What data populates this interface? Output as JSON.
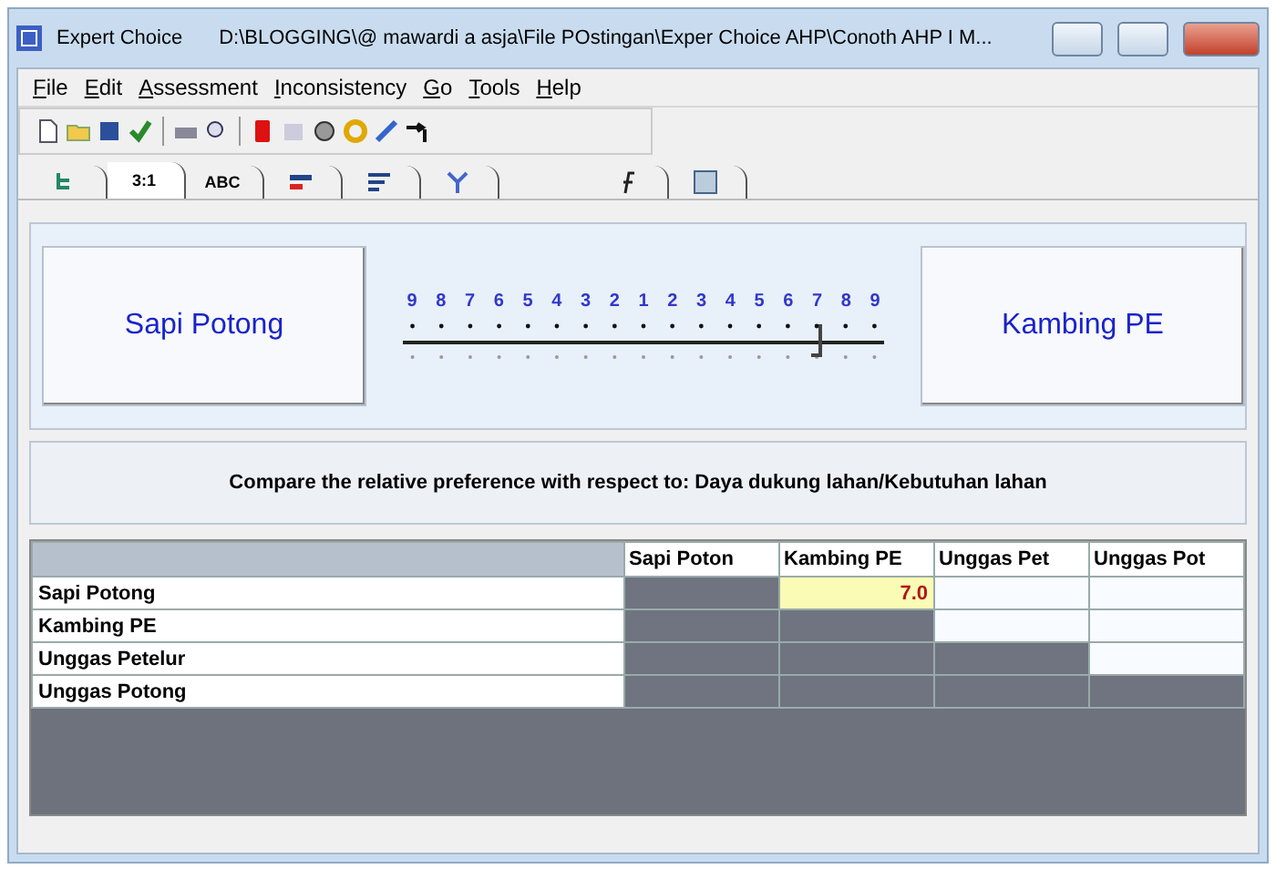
{
  "window": {
    "title": "Expert Choice",
    "path": "D:\\BLOGGING\\@ mawardi a asja\\File POstingan\\Exper Choice AHP\\Conoth AHP I M..."
  },
  "menu": [
    {
      "label": "File"
    },
    {
      "label": "Edit"
    },
    {
      "label": "Assessment"
    },
    {
      "label": "Inconsistency"
    },
    {
      "label": "Go"
    },
    {
      "label": "Tools"
    },
    {
      "label": "Help"
    }
  ],
  "tabs": [
    {
      "kind": "tree",
      "selected": false
    },
    {
      "kind": "text",
      "label": "3:1",
      "selected": true
    },
    {
      "kind": "text",
      "label": "ABC",
      "selected": false
    },
    {
      "kind": "bars",
      "selected": false
    },
    {
      "kind": "lines",
      "selected": false
    },
    {
      "kind": "arrows",
      "selected": false
    },
    {
      "kind": "formula",
      "selected": false
    },
    {
      "kind": "table",
      "selected": false
    }
  ],
  "comparison": {
    "left": "Sapi Potong",
    "right": "Kambing PE",
    "scale": [
      "9",
      "8",
      "7",
      "6",
      "5",
      "4",
      "3",
      "2",
      "1",
      "2",
      "3",
      "4",
      "5",
      "6",
      "7",
      "8",
      "9"
    ],
    "level": 0.875
  },
  "prompt": "Compare the relative preference with respect to: Daya dukung lahan/Kebutuhan lahan",
  "matrix": {
    "columns": [
      "Sapi Poton",
      "Kambing PE",
      "Unggas Pet",
      "Unggas Pot"
    ],
    "rows": [
      {
        "label": "Sapi Potong",
        "cells": [
          {
            "kind": "grey"
          },
          {
            "kind": "value",
            "text": "7.0"
          },
          {
            "kind": "blank"
          },
          {
            "kind": "blank"
          }
        ]
      },
      {
        "label": "Kambing PE",
        "cells": [
          {
            "kind": "grey"
          },
          {
            "kind": "grey"
          },
          {
            "kind": "blank"
          },
          {
            "kind": "blank"
          }
        ]
      },
      {
        "label": "Unggas Petelur",
        "cells": [
          {
            "kind": "grey"
          },
          {
            "kind": "grey"
          },
          {
            "kind": "grey"
          },
          {
            "kind": "blank"
          }
        ]
      },
      {
        "label": "Unggas Potong",
        "cells": [
          {
            "kind": "grey"
          },
          {
            "kind": "grey"
          },
          {
            "kind": "grey"
          },
          {
            "kind": "grey"
          }
        ]
      }
    ]
  }
}
